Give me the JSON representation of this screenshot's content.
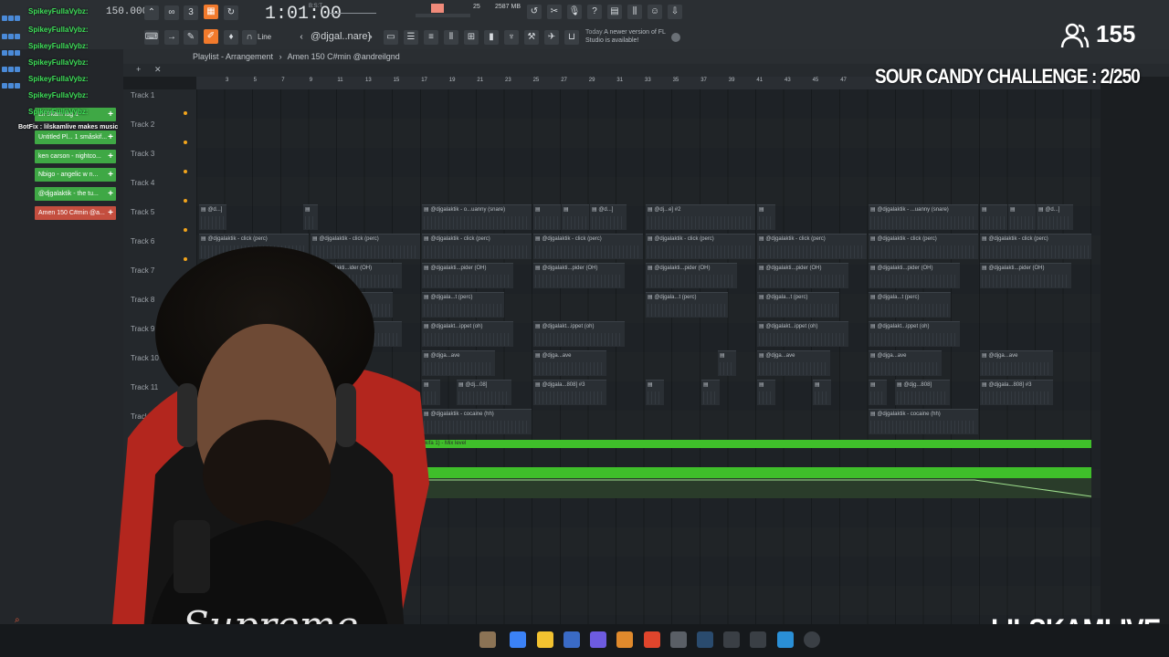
{
  "toolbar": {
    "bpm": "150.000",
    "time": "1:01:00",
    "time_sub": "B:S:T",
    "memory": "2587 MB",
    "memory_sub": "25",
    "pattern_name": "@djgal..nare}",
    "snap": "Line",
    "update_note_date": "Today",
    "update_note": "A newer version of FL Studio is available!"
  },
  "chat": {
    "lines": [
      "SpikeyFullaVybz:",
      "SpikeyFullaVybz:",
      "SpikeyFullaVybz:",
      "SpikeyFullaVybz:",
      "SpikeyFullaVybz:",
      "SpikeyFullaVybz:",
      "SpikeyFullaVybz:",
      "BotFix : lilskamlive makes music"
    ]
  },
  "patterns": [
    {
      "label": "Lil Skam lag 1",
      "selected": false
    },
    {
      "label": "Untitled Pl... 1 småskif...",
      "selected": false
    },
    {
      "label": "ken carson - nightco...",
      "selected": false
    },
    {
      "label": "Nbigo - angelic w n...",
      "selected": false
    },
    {
      "label": "@djgalaktik - the tu...",
      "selected": false
    },
    {
      "label": "Amen 150 C#min @a...",
      "selected": true
    }
  ],
  "playlist": {
    "title": "Playlist - Arrangement",
    "separator": "›",
    "pattern": "Amen 150 C#min @andreilgnd",
    "ruler_ticks": [
      "3",
      "5",
      "7",
      "9",
      "11",
      "13",
      "15",
      "17",
      "19",
      "21",
      "23",
      "25",
      "27",
      "29",
      "31",
      "33",
      "35",
      "37",
      "39",
      "41",
      "43",
      "45",
      "47"
    ],
    "tracks": [
      "Track 1",
      "Track 2",
      "Track 3",
      "Track 4",
      "Track 5",
      "Track 6",
      "Track 7",
      "Track 8",
      "Track 9",
      "Track 10",
      "Track 11",
      "Track 12"
    ],
    "automation_label": "småskifa 1) - Mix level"
  },
  "clip_names": {
    "t3": [
      "@d...]",
      "@djgalaktik - o...uanny (snare)",
      "@d...]",
      "@dj...e] #2",
      "@djgalaktik - ...uanny (snare)",
      "@d...]"
    ],
    "t4": [
      "@djgalaktik - click (perc)"
    ],
    "t5": [
      "@djgalakti...ider (OH)",
      "@djgalakti...pider (OH)"
    ],
    "t6": [
      "@djgala...perc]",
      "@djgala...t (perc)"
    ],
    "t7": [
      "@djgalakt...ippet (oh)"
    ],
    "t8": [
      "@djga...ave"
    ],
    "t9": [
      "@dj...08]",
      "@djgala...808] #3",
      "@djg...808]"
    ],
    "t10": [
      "@djgalaktik - cocaine (hh)"
    ]
  },
  "overlay": {
    "viewers": "155",
    "challenge": "SOUR CANDY CHALLENGE : 2/250",
    "channel": "LILSKAMLIVE"
  },
  "colors": {
    "accent_orange": "#f27a2c",
    "pattern_green": "#3fa845",
    "pattern_selected": "#c44e3f",
    "automation_green": "#3fbf2a",
    "ruler_line": "#3bd05a"
  }
}
